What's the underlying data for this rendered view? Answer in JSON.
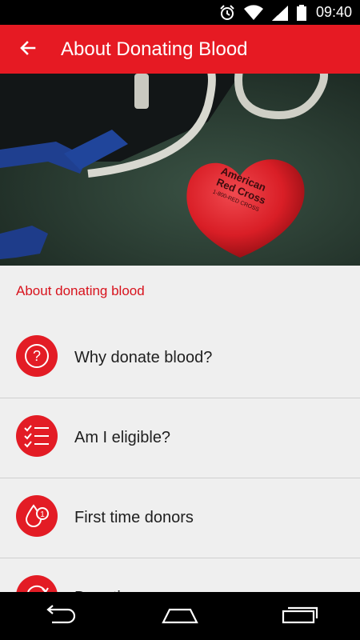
{
  "status_bar": {
    "time": "09:40",
    "icons": [
      "alarm-icon",
      "wifi-icon",
      "signal-icon",
      "battery-icon"
    ]
  },
  "app_bar": {
    "title": "About Donating Blood",
    "back_icon": "arrow-back-icon",
    "color": "#e61a23"
  },
  "hero": {
    "description_icon": "stress-ball-heart-with-stethoscope",
    "heart_text": [
      "American",
      "Red Cross",
      "1-800-RED CROSS"
    ]
  },
  "section": {
    "title": "About donating blood"
  },
  "list": [
    {
      "label": "Why donate blood?",
      "icon": "question-icon"
    },
    {
      "label": "Am I eligible?",
      "icon": "checklist-icon"
    },
    {
      "label": "First time donors",
      "icon": "blood-drop-first-icon"
    },
    {
      "label": "Donation process",
      "icon": "donation-process-icon"
    }
  ],
  "nav_bar": {
    "icons": [
      "back-nav-icon",
      "home-nav-icon",
      "recents-nav-icon"
    ]
  },
  "colors": {
    "accent": "#e61a23",
    "section_text": "#d8131d",
    "background": "#efefef"
  }
}
